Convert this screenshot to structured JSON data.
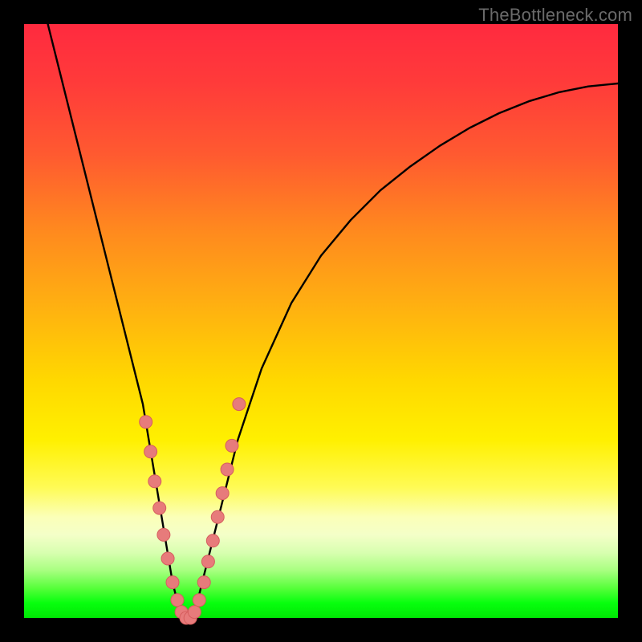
{
  "watermark": "TheBottleneck.com",
  "chart_data": {
    "type": "line",
    "title": "",
    "xlabel": "",
    "ylabel": "",
    "xlim": [
      0,
      100
    ],
    "ylim": [
      0,
      100
    ],
    "series": [
      {
        "name": "bottleneck-curve",
        "x": [
          4,
          6,
          8,
          10,
          12,
          14,
          16,
          18,
          20,
          22,
          23,
          24,
          25,
          26,
          27,
          28,
          29,
          30,
          32,
          34,
          36,
          40,
          45,
          50,
          55,
          60,
          65,
          70,
          75,
          80,
          85,
          90,
          95,
          100
        ],
        "y": [
          100,
          92,
          84,
          76,
          68,
          60,
          52,
          44,
          36,
          24,
          18,
          12,
          6,
          2,
          0,
          0,
          2,
          6,
          14,
          22,
          30,
          42,
          53,
          61,
          67,
          72,
          76,
          79.5,
          82.5,
          85,
          87,
          88.5,
          89.5,
          90
        ]
      }
    ],
    "markers": {
      "name": "scatter-points",
      "x": [
        20.5,
        21.3,
        22.0,
        22.8,
        23.5,
        24.2,
        25.0,
        25.8,
        26.5,
        27.3,
        28.0,
        28.7,
        29.5,
        30.3,
        31.0,
        31.8,
        32.6,
        33.4,
        34.2,
        35.0,
        36.2
      ],
      "y": [
        33,
        28,
        23,
        18.5,
        14,
        10,
        6,
        3,
        1,
        0,
        0,
        1,
        3,
        6,
        9.5,
        13,
        17,
        21,
        25,
        29,
        36
      ]
    },
    "colors": {
      "curve": "#000000",
      "marker_fill": "#e77b7b",
      "marker_stroke": "#d65e5e"
    }
  }
}
